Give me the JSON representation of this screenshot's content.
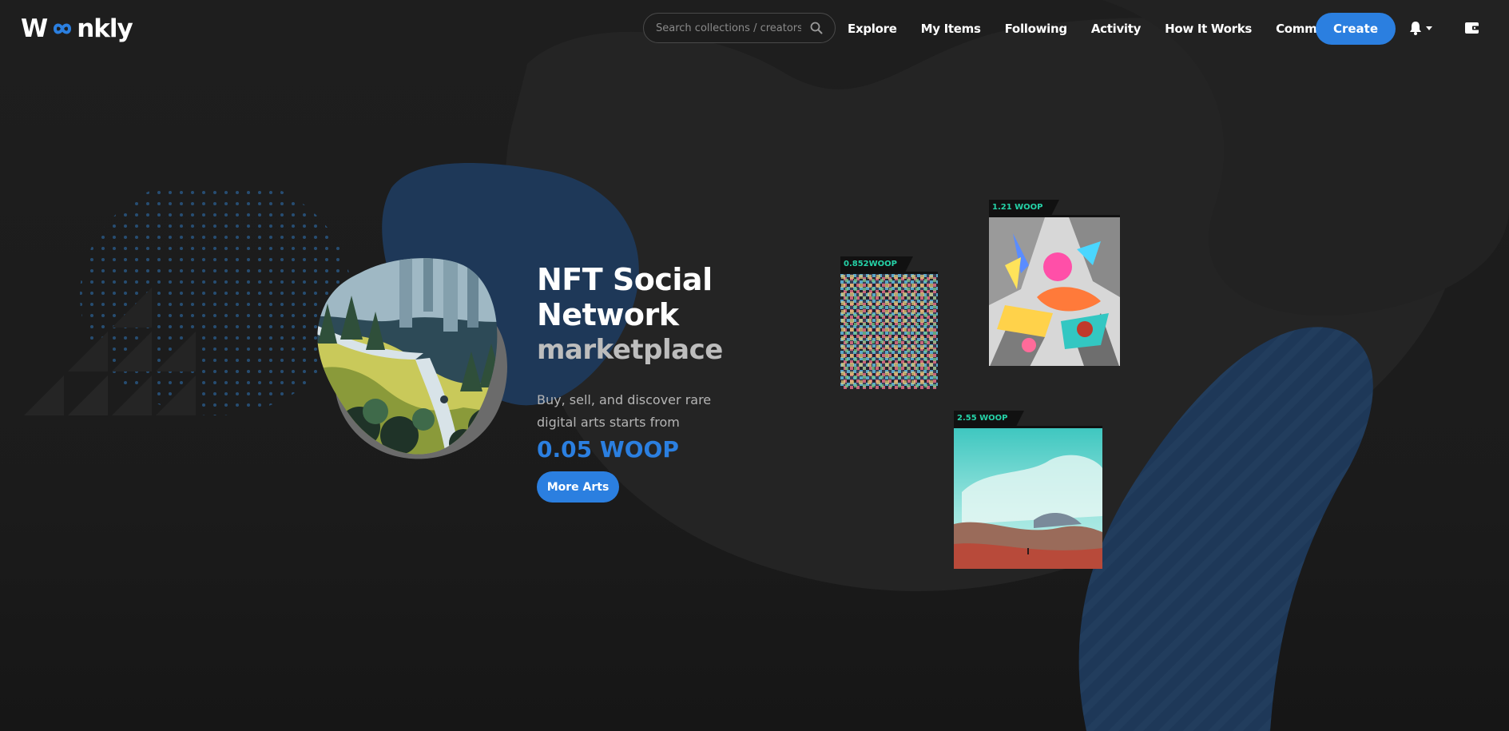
{
  "app": {
    "logo_text_left": "W",
    "logo_text_right": "nkly",
    "accent_color": "#2b7fe0",
    "price_tag_color": "#25d3a8"
  },
  "navbar": {
    "search": {
      "placeholder": "Search collections / creators",
      "icon": "search-icon"
    },
    "links": [
      "Explore",
      "My Items",
      "Following",
      "Activity",
      "How It Works"
    ],
    "community_label": "Community",
    "create_label": "Create",
    "bell_icon": "bell-icon",
    "wallet_icon": "wallet-icon"
  },
  "hero": {
    "title_line1": "NFT Social",
    "title_line2": "Network",
    "subtitle": "marketplace",
    "description": "Buy, sell, and discover rare digital arts starts from",
    "price": "0.05 WOOP",
    "cta_label": "More Arts"
  },
  "nfts": [
    {
      "price": "0.852WOOP"
    },
    {
      "price": "1.21 WOOP"
    },
    {
      "price": "2.55 WOOP"
    }
  ]
}
